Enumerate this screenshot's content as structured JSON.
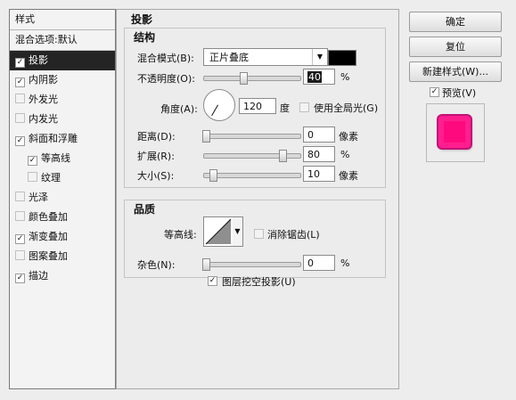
{
  "left_panel": {
    "header": "样式",
    "blend_options": "混合选项:默认",
    "items": [
      {
        "label": "投影",
        "checked": true,
        "active": true
      },
      {
        "label": "内阴影",
        "checked": true
      },
      {
        "label": "外发光",
        "checked": false
      },
      {
        "label": "内发光",
        "checked": false
      },
      {
        "label": "斜面和浮雕",
        "checked": true
      },
      {
        "label": "等高线",
        "checked": true,
        "sub": true
      },
      {
        "label": "纹理",
        "checked": false,
        "sub": true
      },
      {
        "label": "光泽",
        "checked": false
      },
      {
        "label": "颜色叠加",
        "checked": false
      },
      {
        "label": "渐变叠加",
        "checked": true
      },
      {
        "label": "图案叠加",
        "checked": false
      },
      {
        "label": "描边",
        "checked": true
      }
    ]
  },
  "main": {
    "title": "投影",
    "structure": {
      "title": "结构",
      "blend_mode_label": "混合模式(B):",
      "blend_mode_value": "正片叠底",
      "blend_color": "#000000",
      "opacity_label": "不透明度(O):",
      "opacity_value": "40",
      "percent": "%",
      "angle_label": "角度(A):",
      "angle_value": "120",
      "degree": "度",
      "global_light_label": "使用全局光(G)",
      "global_light_checked": false,
      "distance_label": "距离(D):",
      "distance_value": "0",
      "px": "像素",
      "spread_label": "扩展(R):",
      "spread_value": "80",
      "size_label": "大小(S):",
      "size_value": "10"
    },
    "quality": {
      "title": "品质",
      "contour_label": "等高线:",
      "anti_alias_label": "消除锯齿(L)",
      "anti_alias_checked": false,
      "noise_label": "杂色(N):",
      "noise_value": "0",
      "percent": "%"
    },
    "knockout_label": "图层挖空投影(U)",
    "knockout_checked": true
  },
  "buttons": {
    "ok": "确定",
    "reset": "复位",
    "new_style": "新建样式(W)...",
    "preview_label": "预览(V)",
    "preview_checked": true
  },
  "colors": {
    "accent_preview": "#ff1e8e",
    "active_item_bg": "#242424"
  }
}
